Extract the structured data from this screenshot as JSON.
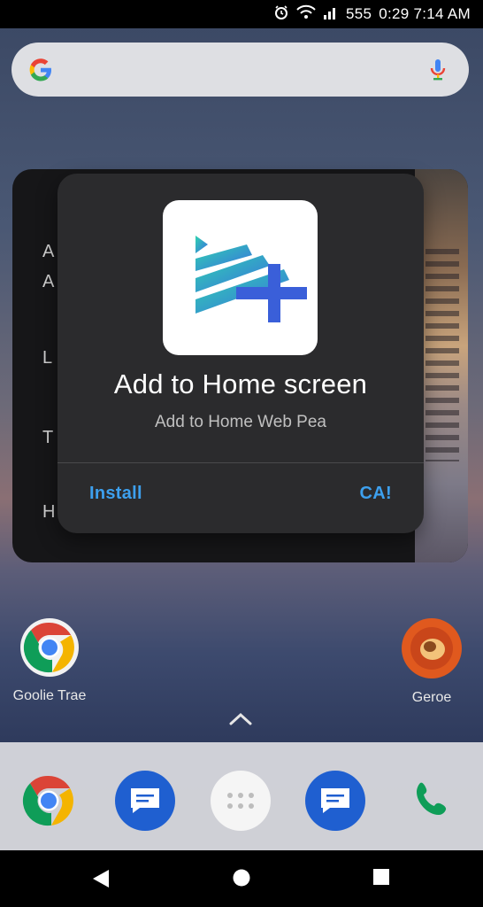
{
  "status_bar": {
    "icons": [
      "alarm-icon",
      "wifi-icon",
      "signal-icon"
    ],
    "battery_text": "555",
    "time": "0:29 7:14 AM"
  },
  "search_bar": {
    "logo": "google-g-icon",
    "mic": "mic-icon"
  },
  "background_card": {
    "lines": [
      "A",
      "A",
      "L",
      "T",
      "H"
    ]
  },
  "dialog": {
    "title": "Add to Home screen",
    "subtitle": "Add to Home Web Pea",
    "install_label": "Install",
    "cancel_label": "CA!",
    "accent_color": "#3da0ee"
  },
  "home_apps": [
    {
      "label": "Goolie Trae",
      "icon": "chrome-icon"
    },
    {
      "label": "Geroe",
      "icon": "game-app-icon"
    }
  ],
  "dock": {
    "apps": [
      "chrome-icon",
      "messages-icon",
      "app-drawer-icon",
      "messages-icon",
      "phone-icon"
    ]
  },
  "nav_bar": {
    "buttons": [
      "back-icon",
      "home-icon",
      "recents-icon"
    ]
  }
}
